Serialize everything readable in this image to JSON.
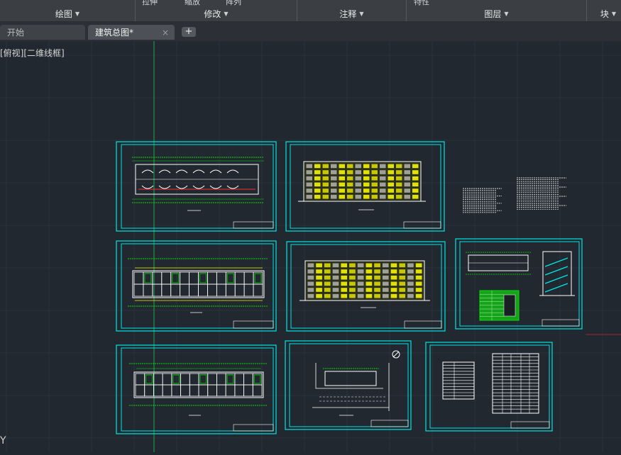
{
  "ribbon": {
    "top_fragments": [
      "拉伸",
      "缩放",
      "阵列",
      "特性"
    ],
    "panels": [
      {
        "label": "绘图"
      },
      {
        "label": "修改"
      },
      {
        "label": "注释"
      },
      {
        "label": "图层"
      },
      {
        "label": "块"
      }
    ]
  },
  "tabs": [
    {
      "label": "开始"
    },
    {
      "label": "建筑总图*"
    }
  ],
  "tab_close_symbol": "×",
  "new_tab_symbol": "+",
  "viewport": {
    "view_label": "[俯视][二维线框]",
    "ucs_label": "Y",
    "background": "#212830",
    "frame_color": "#00e5e5",
    "drawing_line_color": "#ffffff",
    "highlight_color": "#f5f500",
    "accent_color": "#00e000"
  },
  "sheets": [
    {
      "kind": "floor-plan"
    },
    {
      "kind": "elevation"
    },
    {
      "kind": "notes"
    },
    {
      "kind": "floor-plan"
    },
    {
      "kind": "elevation"
    },
    {
      "kind": "section"
    },
    {
      "kind": "floor-plan"
    },
    {
      "kind": "site-plan"
    },
    {
      "kind": "schedule"
    }
  ]
}
